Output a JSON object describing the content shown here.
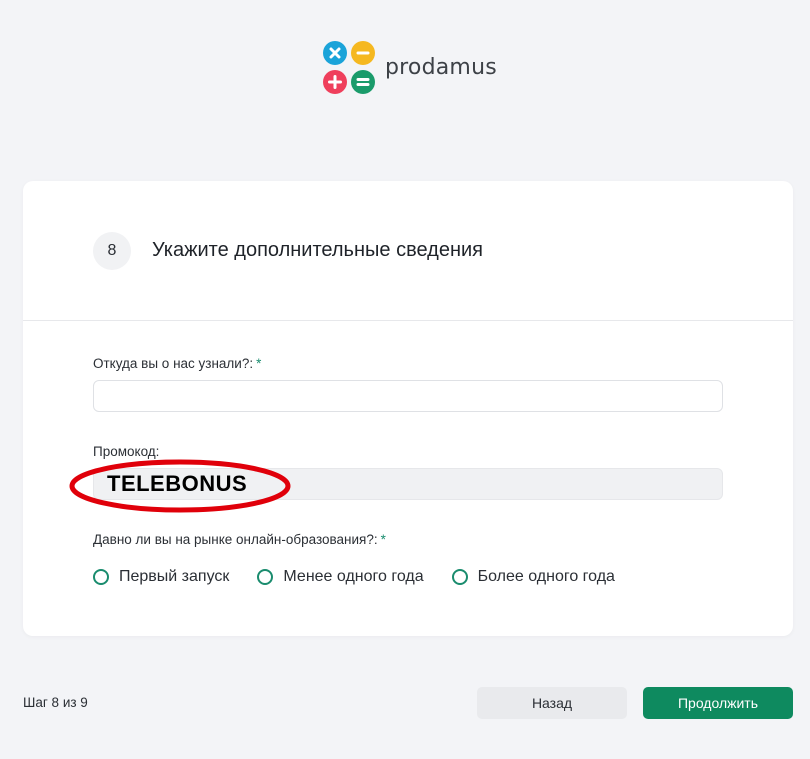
{
  "brand": {
    "name": "prodamus",
    "colors": {
      "blue": "#1aa3d9",
      "yellow": "#f5b820",
      "red": "#ef3f5c",
      "green": "#1a9b6b"
    }
  },
  "card": {
    "step_number": "8",
    "title": "Укажите дополнительные сведения",
    "fields": {
      "source": {
        "label": "Откуда вы о нас узнали?:",
        "required_mark": "*",
        "value": ""
      },
      "promo": {
        "label": "Промокод:",
        "value": "TELEBONUS"
      },
      "experience": {
        "label": "Давно ли вы на рынке онлайн-образования?:",
        "required_mark": "*",
        "options": [
          "Первый запуск",
          "Менее одного года",
          "Более одного года"
        ]
      }
    }
  },
  "annotation": {
    "color": "#e0000a",
    "icon": "highlight-ellipse"
  },
  "footer": {
    "step_text": "Шаг 8 из 9",
    "back_label": "Назад",
    "next_label": "Продолжить"
  }
}
